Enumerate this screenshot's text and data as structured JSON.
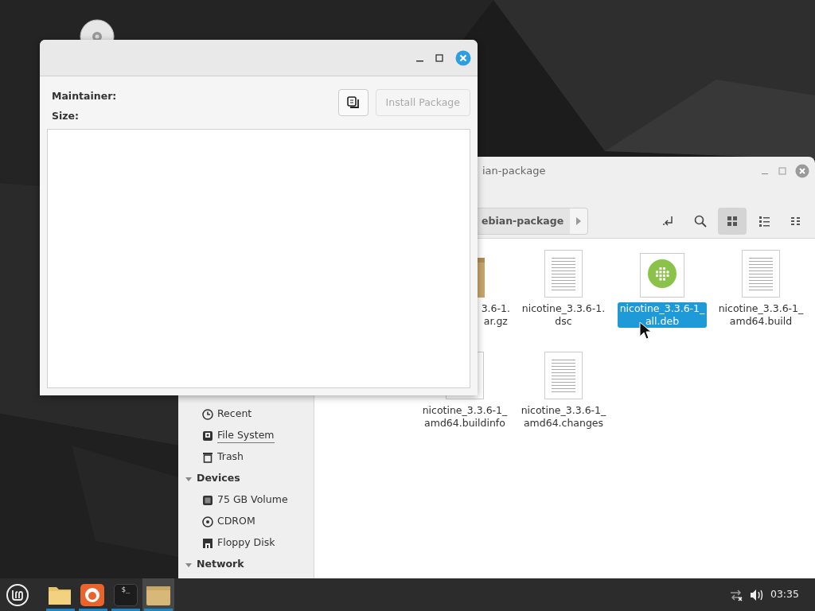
{
  "package_dialog": {
    "window_controls": [
      {
        "kind": "minimize"
      },
      {
        "kind": "maximize"
      },
      {
        "kind": "close"
      }
    ],
    "info_labels": [
      "Maintainer:",
      "Size:"
    ],
    "install_button": {
      "label": "Install Package",
      "disabled": true
    }
  },
  "file_manager": {
    "title": "ian-package",
    "path_segment": "ebian-package",
    "view_modes": [
      {
        "kind": "icons",
        "selected": true
      },
      {
        "kind": "list",
        "selected": false
      },
      {
        "kind": "compact",
        "selected": false
      }
    ],
    "sidebar": {
      "places": [
        {
          "label": "Recent",
          "kind": "recent",
          "underlined": false
        },
        {
          "label": "File System",
          "kind": "filesystem",
          "underlined": true
        },
        {
          "label": "Trash",
          "kind": "trash",
          "underlined": false
        }
      ],
      "sections": [
        {
          "title": "Devices",
          "expanded": true,
          "items": [
            {
              "label": "75 GB Volume",
              "kind": "drive"
            },
            {
              "label": "CDROM",
              "kind": "disc"
            },
            {
              "label": "Floppy Disk",
              "kind": "floppy"
            }
          ]
        },
        {
          "title": "Network",
          "expanded": true
        }
      ]
    },
    "files": [
      {
        "kind": "archive",
        "lines": [
          "3.6-1.",
          "ar.gz"
        ],
        "selected": false
      },
      {
        "kind": "text",
        "lines": [
          "nicotine_3.3.6-1.",
          "dsc"
        ],
        "selected": false
      },
      {
        "kind": "deb",
        "lines": [
          "nicotine_3.3.6-1_",
          "all.deb"
        ],
        "selected": true
      },
      {
        "kind": "text",
        "lines": [
          "nicotine_3.3.6-1_",
          "amd64.build"
        ],
        "selected": false
      },
      {
        "kind": "text",
        "lines": [
          "nicotine_3.3.6-1_",
          "amd64.buildinfo"
        ],
        "selected": false
      },
      {
        "kind": "text",
        "lines": [
          "nicotine_3.3.6-1_",
          "amd64.changes"
        ],
        "selected": false
      }
    ]
  },
  "taskbar": {
    "launchers": [
      {
        "kind": "folder",
        "running": true,
        "active": false
      },
      {
        "kind": "browser",
        "running": true,
        "active": false
      },
      {
        "kind": "terminal",
        "text": "$_",
        "running": true,
        "active": false
      },
      {
        "kind": "files",
        "running": true,
        "active": true
      }
    ],
    "clock": "03:35"
  }
}
